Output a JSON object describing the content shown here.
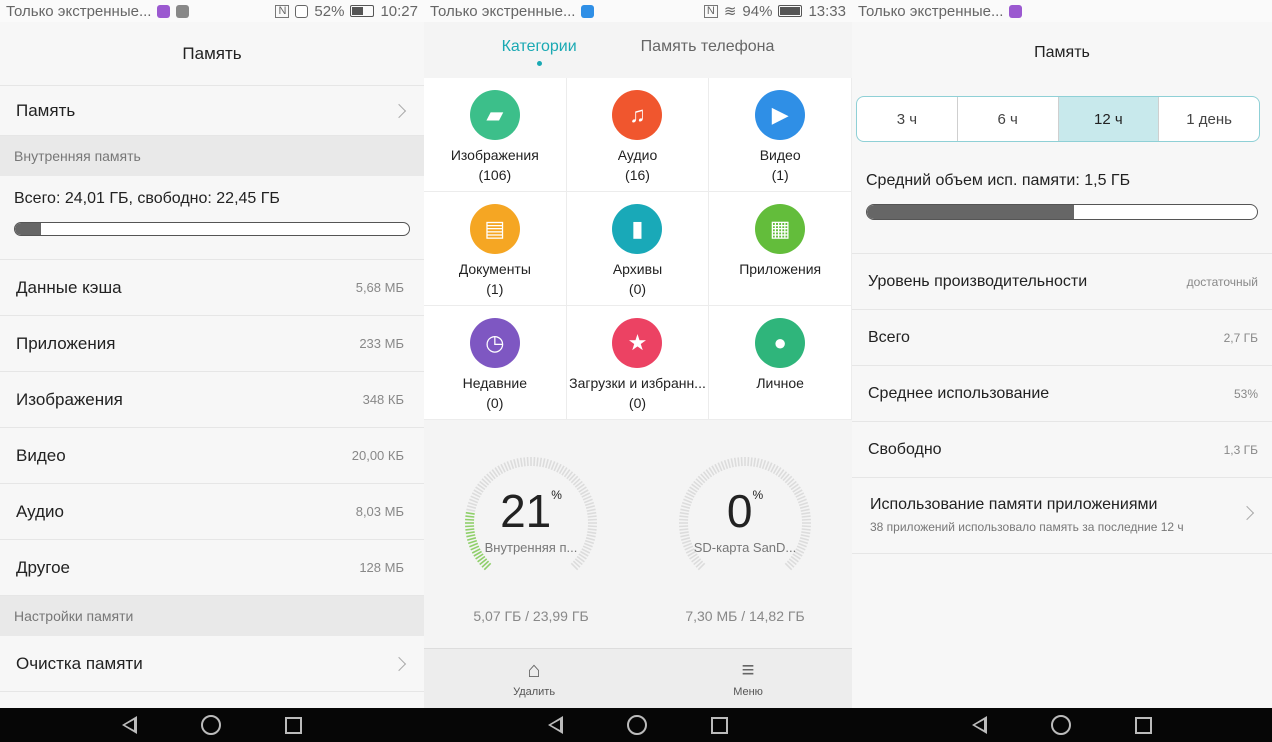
{
  "p1": {
    "status": {
      "left": "Только экстренные...",
      "battery": "52%",
      "time": "10:27"
    },
    "title": "Память",
    "memory_row": "Память",
    "section_internal": "Внутренняя память",
    "total_text": "Всего: 24,01 ГБ, свободно: 22,45 ГБ",
    "usage_fraction": 0.065,
    "items": [
      {
        "label": "Данные кэша",
        "value": "5,68 МБ"
      },
      {
        "label": "Приложения",
        "value": "233 МБ"
      },
      {
        "label": "Изображения",
        "value": "348 КБ"
      },
      {
        "label": "Видео",
        "value": "20,00 КБ"
      },
      {
        "label": "Аудио",
        "value": "8,03 МБ"
      },
      {
        "label": "Другое",
        "value": "128 МБ"
      }
    ],
    "section_settings": "Настройки памяти",
    "clean_row": "Очистка памяти"
  },
  "p2": {
    "status": {
      "left": "Только экстренные...",
      "battery": "94%",
      "time": "13:33"
    },
    "tabs": [
      "Категории",
      "Память телефона"
    ],
    "categories": [
      {
        "name": "Изображения",
        "count": "(106)",
        "icon": "image-icon",
        "color": "#3cbf8a"
      },
      {
        "name": "Аудио",
        "count": "(16)",
        "icon": "music-icon",
        "color": "#f0562e"
      },
      {
        "name": "Видео",
        "count": "(1)",
        "icon": "play-icon",
        "color": "#2f8fe6"
      },
      {
        "name": "Документы",
        "count": "(1)",
        "icon": "document-icon",
        "color": "#f5a623"
      },
      {
        "name": "Архивы",
        "count": "(0)",
        "icon": "archive-icon",
        "color": "#19a9b8"
      },
      {
        "name": "Приложения",
        "count": "",
        "icon": "apps-icon",
        "color": "#63bd3b"
      },
      {
        "name": "Недавние",
        "count": "(0)",
        "icon": "clock-icon",
        "color": "#7e57c2"
      },
      {
        "name": "Загрузки и избранн...",
        "count": "(0)",
        "icon": "star-icon",
        "color": "#ec4263"
      },
      {
        "name": "Личное",
        "count": "",
        "icon": "lock-icon",
        "color": "#2fb57b"
      }
    ],
    "gauges": [
      {
        "percent": "21",
        "name": "Внутренняя п...",
        "size": "5,07 ГБ / 23,99 ГБ",
        "fraction": 0.21
      },
      {
        "percent": "0",
        "name": "SD-карта SanD...",
        "size": "7,30 МБ / 14,82 ГБ",
        "fraction": 0.0
      }
    ],
    "percent_sign": "%",
    "bottom": {
      "delete": "Удалить",
      "menu": "Меню"
    }
  },
  "p3": {
    "title": "Память",
    "segments": [
      "3 ч",
      "6 ч",
      "12 ч",
      "1 день"
    ],
    "selected_segment": "12 ч",
    "avg_text": "Средний объем исп. памяти: 1,5 ГБ",
    "avg_fraction": 0.53,
    "rows": [
      {
        "label": "Уровень производительности",
        "value": "достаточный"
      },
      {
        "label": "Всего",
        "value": "2,7 ГБ"
      },
      {
        "label": "Среднее использование",
        "value": "53%"
      },
      {
        "label": "Свободно",
        "value": "1,3 ГБ"
      }
    ],
    "apps_title": "Использование памяти приложениями",
    "apps_sub": "38 приложений использовало память за последние 12 ч"
  }
}
